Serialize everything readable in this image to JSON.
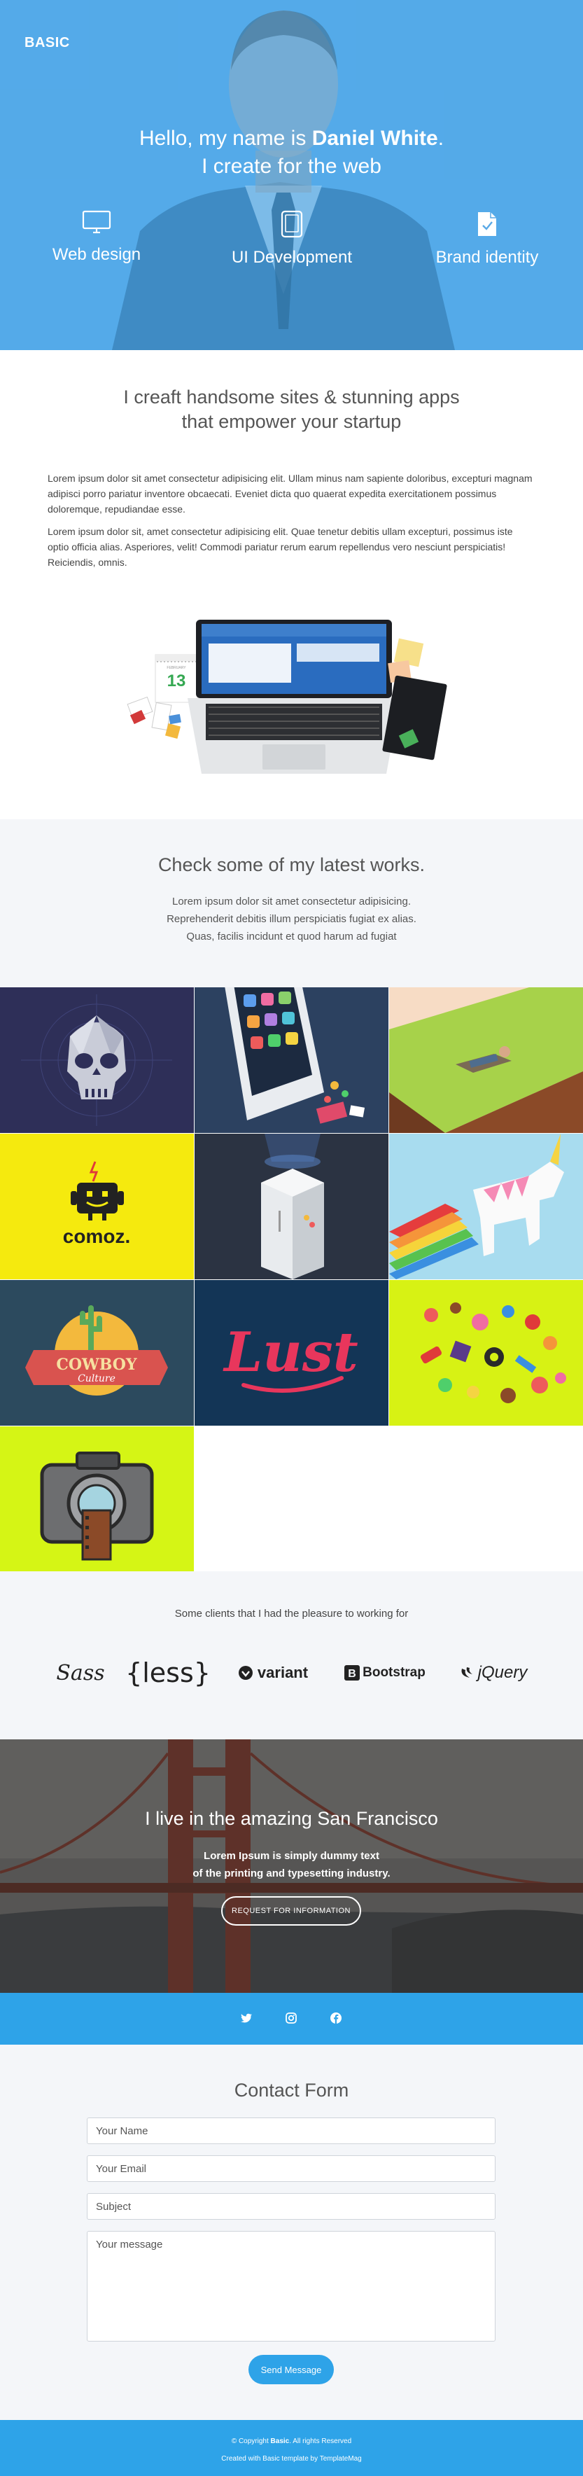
{
  "brand": "BASIC",
  "hero": {
    "line1_prefix": "Hello, my name is ",
    "line1_name": "Daniel White",
    "line1_suffix": ".",
    "line2": "I create for the web",
    "services": [
      {
        "label": "Web design",
        "icon": "monitor-icon"
      },
      {
        "label": "UI Development",
        "icon": "tablet-icon"
      },
      {
        "label": "Brand identity",
        "icon": "document-check-icon"
      }
    ]
  },
  "intro": {
    "heading_line1": "I creaft handsome sites & stunning apps",
    "heading_line2": "that empower your startup",
    "paragraph1": "Lorem ipsum dolor sit amet consectetur adipisicing elit. Ullam minus nam sapiente doloribus, excepturi magnam adipisci porro pariatur inventore obcaecati. Eveniet dicta quo quaerat expedita exercitationem possimus doloremque, repudiandae esse.",
    "paragraph2": "Lorem ipsum dolor sit, amet consectetur adipisicing elit. Quae tenetur debitis ullam excepturi, possimus iste optio officia alias. Asperiores, velit! Commodi pariatur rerum earum repellendus vero nesciunt perspiciatis! Reiciendis, omnis.",
    "calendar_month": "FEBRUARY",
    "calendar_day": "13"
  },
  "works": {
    "heading": "Check some of my latest works.",
    "line1": "Lorem ipsum dolor sit amet consectetur adipisicing.",
    "line2": "Reprehenderit debitis illum perspiciatis fugiat ex alias.",
    "line3": "Quas, facilis incidunt et quod harum ad fugiat",
    "tiles": [
      {
        "name": "skull",
        "bg": "#2e2f58"
      },
      {
        "name": "phone",
        "bg": "#2c4160"
      },
      {
        "name": "hammock",
        "bg": "#f6e0c8"
      },
      {
        "name": "comoz",
        "bg": "#f5ea0e",
        "text": "comoz."
      },
      {
        "name": "fridge",
        "bg": "#2b3342"
      },
      {
        "name": "unicorn",
        "bg": "#a8dcef"
      },
      {
        "name": "cowboy",
        "bg": "#2c4a5e",
        "text1": "COWBOY",
        "text2": "Culture"
      },
      {
        "name": "lust",
        "bg": "#133556",
        "text": "Lust"
      },
      {
        "name": "candy",
        "bg": "#d7f214"
      },
      {
        "name": "camera",
        "bg": "#d5f515"
      }
    ]
  },
  "clients": {
    "lead": "Some clients that I had the pleasure to working for",
    "logos": [
      "Sass",
      "{less}",
      "variant",
      "Bootstrap",
      "jQuery"
    ]
  },
  "sf": {
    "heading": "I live in the amazing San Francisco",
    "line1": "Lorem Ipsum is simply dummy text",
    "line2": "of the printing and typesetting industry.",
    "button": "REQUEST FOR INFORMATION"
  },
  "social": [
    "twitter-icon",
    "instagram-icon",
    "facebook-icon"
  ],
  "contact": {
    "heading": "Contact Form",
    "name_placeholder": "Your Name",
    "email_placeholder": "Your Email",
    "subject_placeholder": "Subject",
    "message_placeholder": "Your message",
    "button": "Send Message"
  },
  "footer": {
    "copyright_prefix": "© Copyright ",
    "copyright_brand": "Basic",
    "copyright_suffix": ". All rights Reserved",
    "credit": "Created with Basic template by TemplateMag"
  },
  "colors": {
    "accent": "#2ea3e8",
    "hero_overlay": "#42a5ec",
    "light_bg": "#f4f6f9"
  }
}
